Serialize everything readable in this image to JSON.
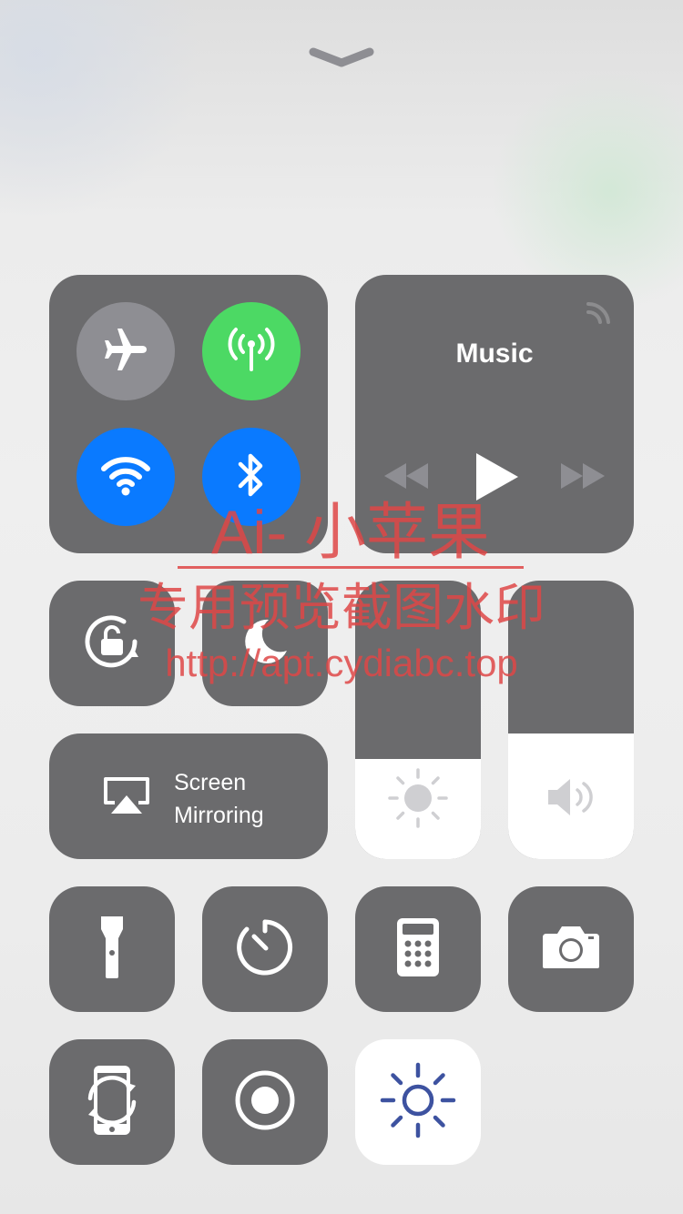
{
  "dismiss": {
    "icon": "chevron-down-icon"
  },
  "connectivity": {
    "airplane": {
      "icon": "airplane-icon",
      "active": false,
      "color": "#8e8e93"
    },
    "cellular": {
      "icon": "cellular-antenna-icon",
      "active": true,
      "color": "#4cd964"
    },
    "wifi": {
      "icon": "wifi-icon",
      "active": true,
      "color": "#0a7aff"
    },
    "bluetooth": {
      "icon": "bluetooth-icon",
      "active": true,
      "color": "#0a7aff"
    }
  },
  "music": {
    "title": "Music",
    "airplay_icon": "airplay-audio-icon",
    "controls": [
      "rewind-icon",
      "play-icon",
      "fast-forward-icon"
    ]
  },
  "toggles": {
    "rotation_lock": {
      "icon": "rotation-lock-icon"
    },
    "do_not_disturb": {
      "icon": "moon-icon"
    }
  },
  "screen_mirroring": {
    "label_line1": "Screen",
    "label_line2": "Mirroring",
    "icon": "airplay-screen-icon"
  },
  "sliders": {
    "brightness": {
      "icon": "sun-icon",
      "level": 0.36
    },
    "volume": {
      "icon": "speaker-icon",
      "level": 0.45
    }
  },
  "shortcuts": [
    {
      "name": "flashlight",
      "icon": "flashlight-icon"
    },
    {
      "name": "timer",
      "icon": "timer-icon"
    },
    {
      "name": "calculator",
      "icon": "calculator-icon"
    },
    {
      "name": "camera",
      "icon": "camera-icon"
    },
    {
      "name": "auto-rotate",
      "icon": "phone-rotate-icon"
    },
    {
      "name": "screen-record",
      "icon": "record-icon"
    },
    {
      "name": "brightness",
      "icon": "sun-icon",
      "highlighted": true
    }
  ],
  "watermark": {
    "line1": "Ai- 小苹果",
    "line2": "专用预览截图水印",
    "line3": "http://apt.cydiabc.top"
  },
  "colors": {
    "tile": "#6b6b6d",
    "active_green": "#4cd964",
    "active_blue": "#0a7aff",
    "accent_sun": "#3d52a0"
  }
}
